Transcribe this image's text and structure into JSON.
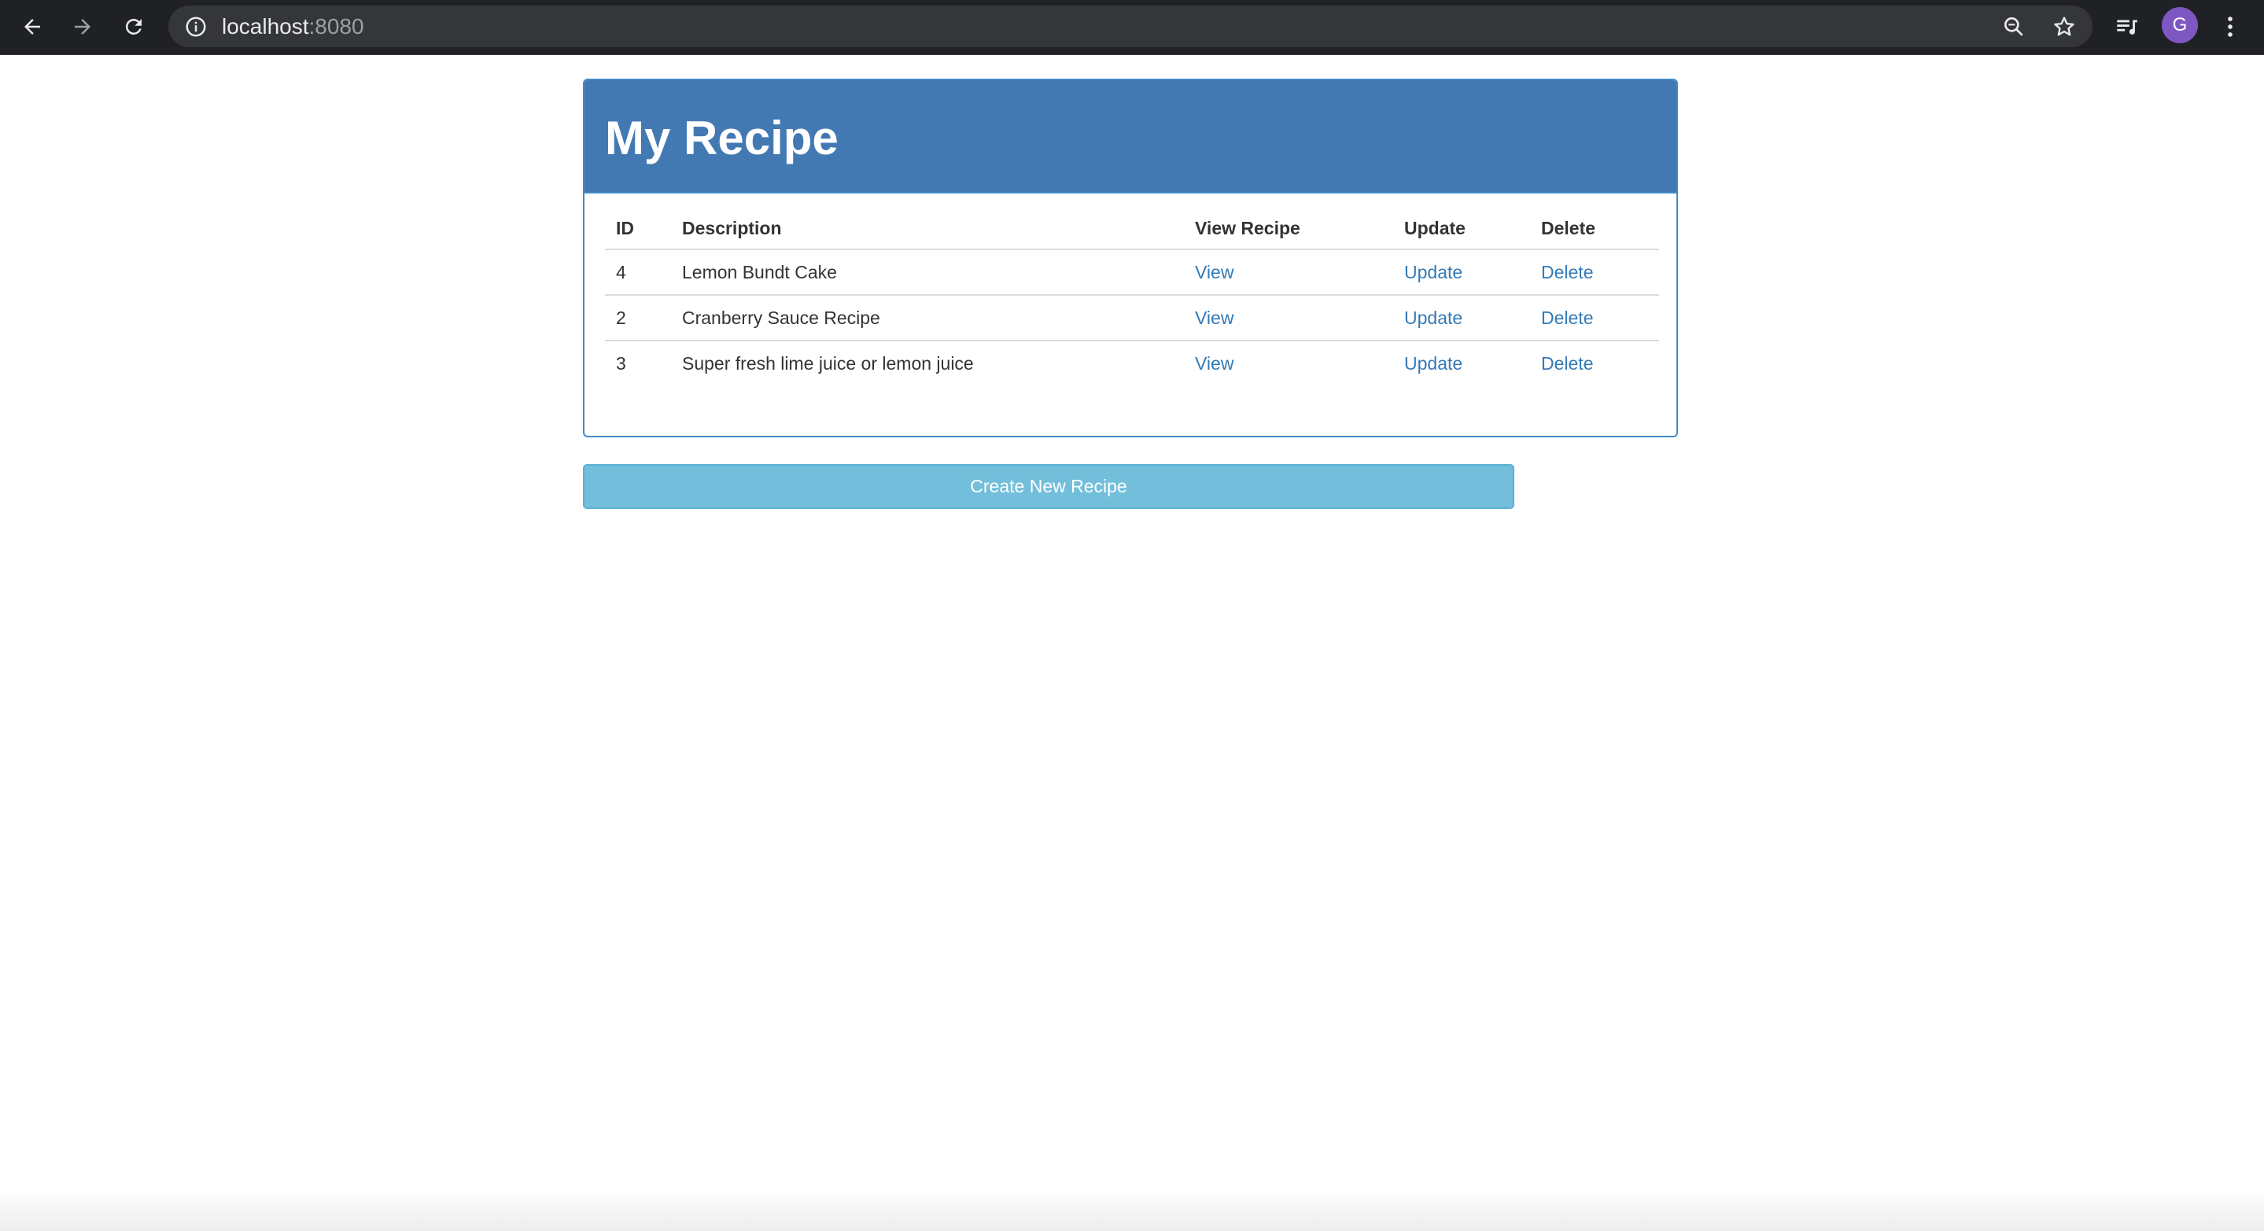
{
  "browser": {
    "url_host": "localhost",
    "url_port": ":8080",
    "avatar_letter": "G"
  },
  "page": {
    "title": "My Recipe",
    "table": {
      "headers": [
        "ID",
        "Description",
        "View Recipe",
        "Update",
        "Delete"
      ],
      "rows": [
        {
          "id": "4",
          "description": "Lemon Bundt Cake",
          "view": "View",
          "update": "Update",
          "delete": "Delete"
        },
        {
          "id": "2",
          "description": "Cranberry Sauce Recipe",
          "view": "View",
          "update": "Update",
          "delete": "Delete"
        },
        {
          "id": "3",
          "description": "Super fresh lime juice or lemon juice",
          "view": "View",
          "update": "Update",
          "delete": "Delete"
        }
      ]
    },
    "create_button_label": "Create New Recipe"
  },
  "colors": {
    "chrome_bg": "#202124",
    "panel_heading_bg": "#4379b3",
    "link": "#337ab7",
    "button_bg": "#73bfdb"
  },
  "icons": [
    "back-arrow-icon",
    "forward-arrow-icon",
    "reload-icon",
    "info-icon",
    "zoom-icon",
    "star-icon",
    "media-queue-icon",
    "kebab-menu-icon"
  ]
}
